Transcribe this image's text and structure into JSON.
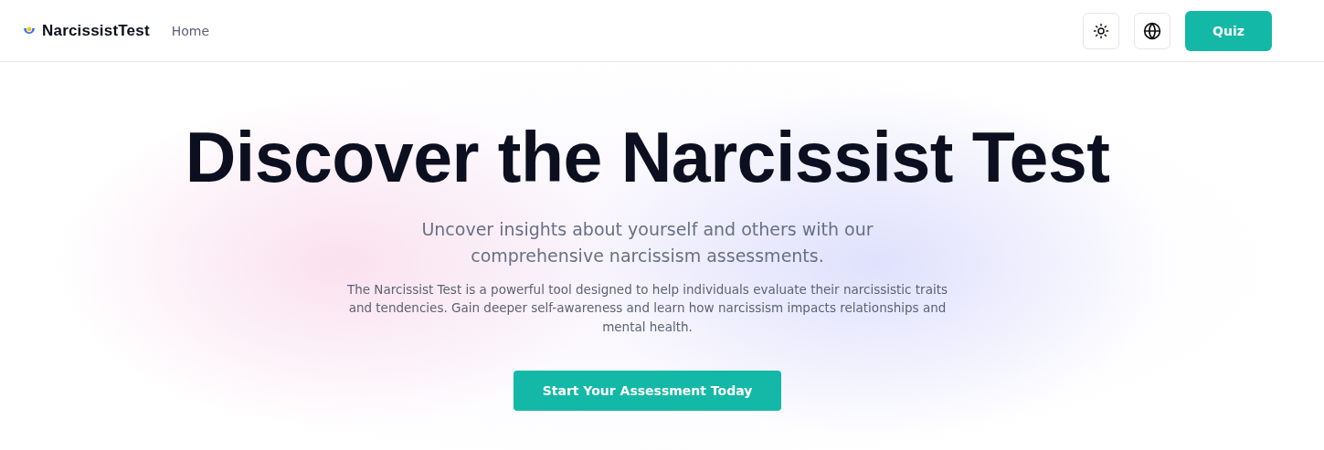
{
  "header": {
    "brand": "NarcissistTest",
    "nav": [
      {
        "label": "Home"
      }
    ],
    "quiz_button": "Quiz"
  },
  "hero": {
    "title": "Discover the Narcissist Test",
    "subtitle": "Uncover insights about yourself and others with our comprehensive narcissism assessments.",
    "description": "The Narcissist Test is a powerful tool designed to help individuals evaluate their narcissistic traits and tendencies. Gain deeper self-awareness and learn how narcissism impacts relationships and mental health.",
    "cta": "Start Your Assessment Today"
  }
}
